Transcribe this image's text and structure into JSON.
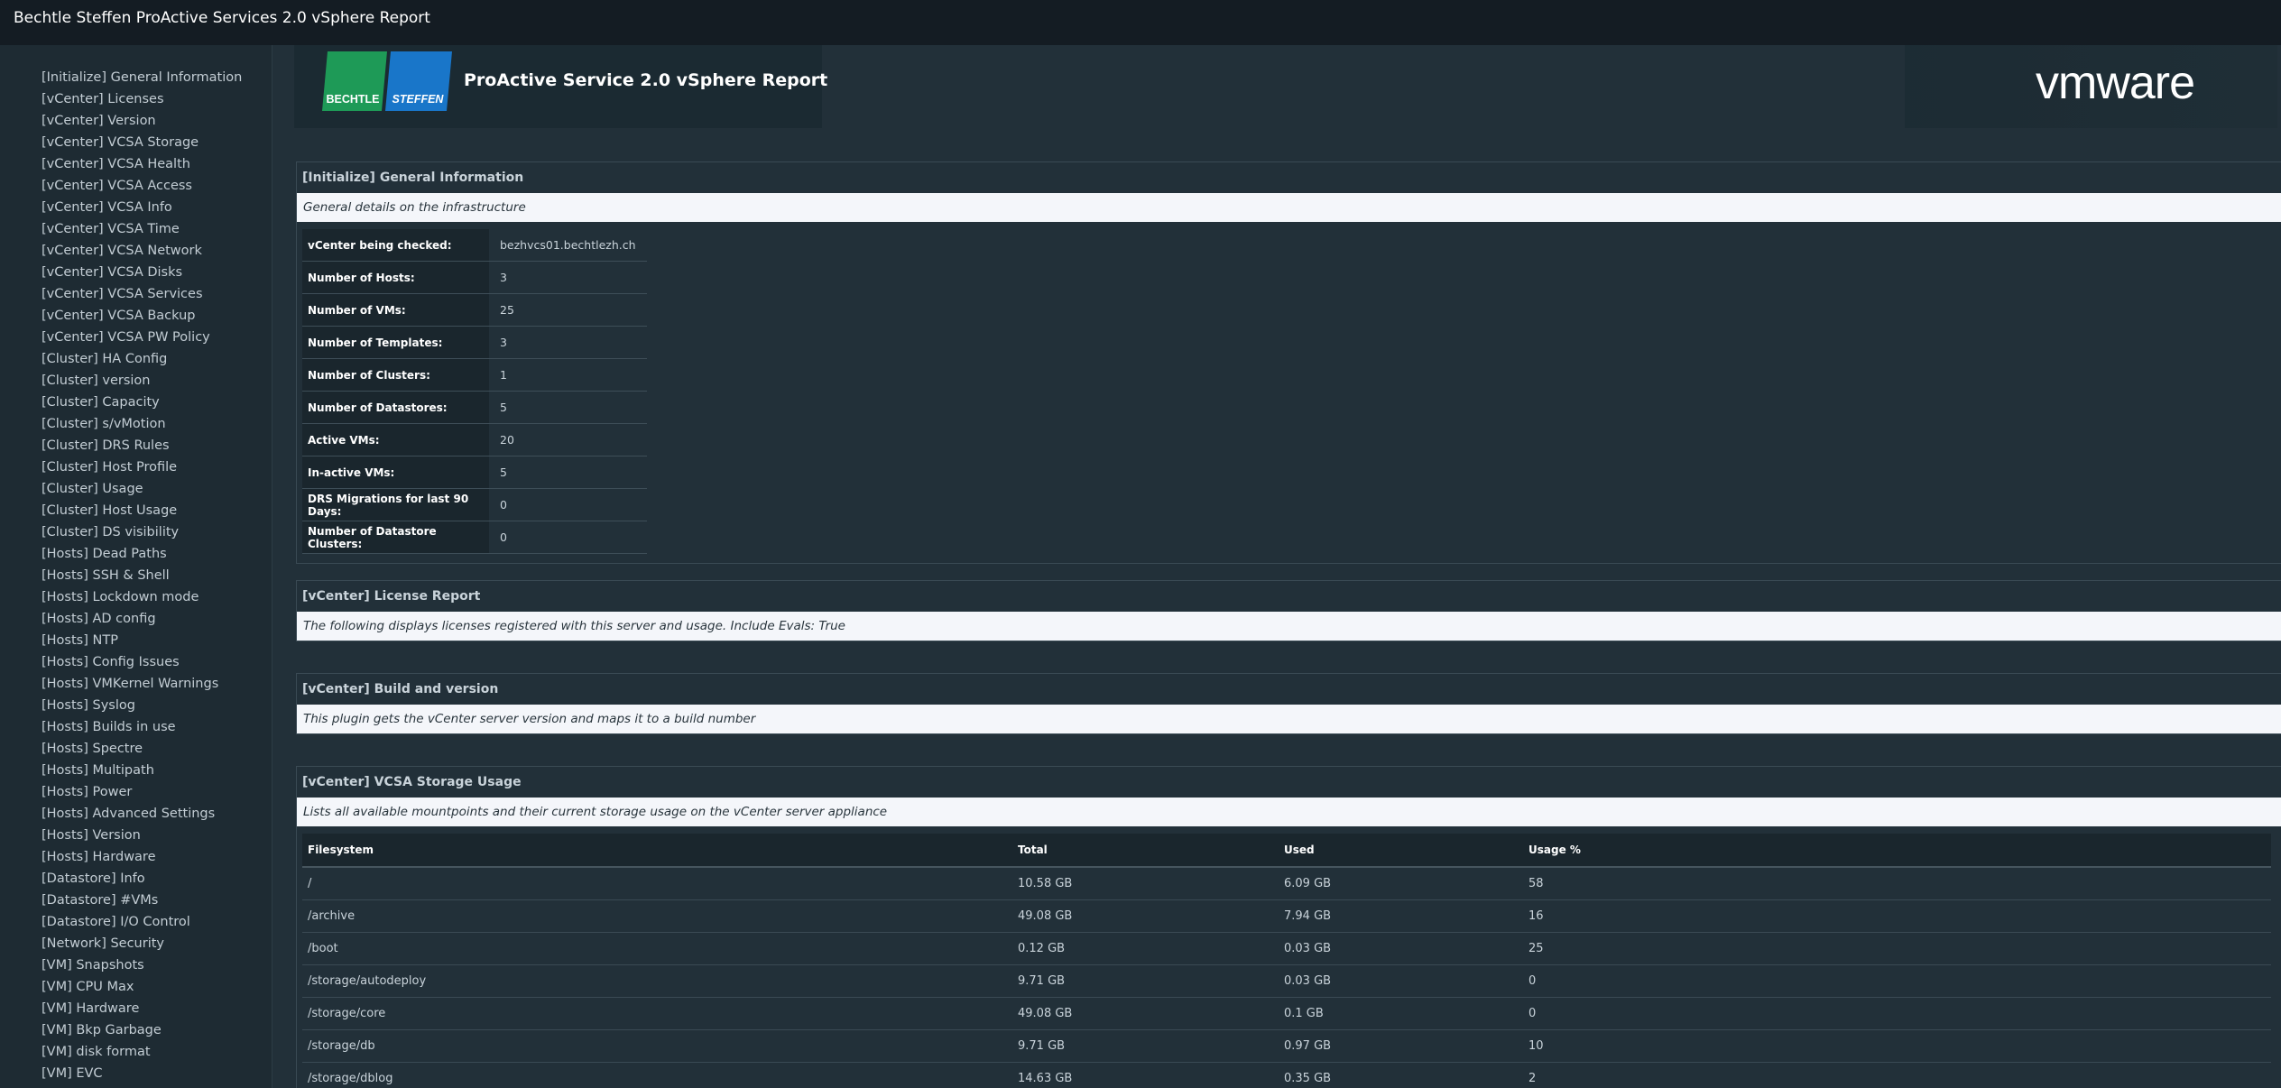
{
  "window": {
    "title": "Bechtle Steffen ProActive Services 2.0 vSphere Report"
  },
  "header": {
    "logo_text_1": "BECHTLE",
    "logo_text_2": "STEFFEN",
    "title": "ProActive Service 2.0 vSphere Report",
    "vmware_logo": "vmware"
  },
  "sidebar": {
    "items": [
      "[Initialize] General Information",
      "[vCenter] Licenses",
      "[vCenter] Version",
      "[vCenter] VCSA Storage",
      "[vCenter] VCSA Health",
      "[vCenter] VCSA Access",
      "[vCenter] VCSA Info",
      "[vCenter] VCSA Time",
      "[vCenter] VCSA Network",
      "[vCenter] VCSA Disks",
      "[vCenter] VCSA Services",
      "[vCenter] VCSA Backup",
      "[vCenter] VCSA PW Policy",
      "[Cluster] HA Config",
      "[Cluster] version",
      "[Cluster] Capacity",
      "[Cluster] s/vMotion",
      "[Cluster] DRS Rules",
      "[Cluster] Host Profile",
      "[Cluster] Usage",
      "[Cluster] Host Usage",
      "[Cluster] DS visibility",
      "[Hosts] Dead Paths",
      "[Hosts] SSH & Shell",
      "[Hosts] Lockdown mode",
      "[Hosts] AD config",
      "[Hosts] NTP",
      "[Hosts] Config Issues",
      "[Hosts] VMKernel Warnings",
      "[Hosts] Syslog",
      "[Hosts] Builds in use",
      "[Hosts] Spectre",
      "[Hosts] Multipath",
      "[Hosts] Power",
      "[Hosts] Advanced Settings",
      "[Hosts] Version",
      "[Hosts] Hardware",
      "[Datastore] Info",
      "[Datastore] #VMs",
      "[Datastore] I/O Control",
      "[Network] Security",
      "[VM] Snapshots",
      "[VM] CPU Max",
      "[VM] Hardware",
      "[VM] Bkp Garbage",
      "[VM] disk format",
      "[VM] EVC"
    ]
  },
  "general": {
    "title": "[Initialize] General Information",
    "description": "General details on the infrastructure",
    "rows": [
      {
        "k": "vCenter being checked:",
        "v": "bezhvcs01.bechtlezh.ch"
      },
      {
        "k": "Number of Hosts:",
        "v": "3"
      },
      {
        "k": "Number of VMs:",
        "v": "25"
      },
      {
        "k": "Number of Templates:",
        "v": "3"
      },
      {
        "k": "Number of Clusters:",
        "v": "1"
      },
      {
        "k": "Number of Datastores:",
        "v": "5"
      },
      {
        "k": "Active VMs:",
        "v": "20"
      },
      {
        "k": "In-active VMs:",
        "v": "5"
      },
      {
        "k": "DRS Migrations for last 90 Days:",
        "v": "0"
      },
      {
        "k": "Number of Datastore Clusters:",
        "v": "0"
      }
    ]
  },
  "license": {
    "title": "[vCenter] License Report",
    "description": "The following displays licenses registered with this server and usage. Include Evals: True"
  },
  "build": {
    "title": "[vCenter] Build and version",
    "description": "This plugin gets the vCenter server version and maps it to a build number"
  },
  "storage": {
    "title": "[vCenter] VCSA Storage Usage",
    "description": "Lists all available mountpoints and their current storage usage on the vCenter server appliance",
    "columns": [
      "Filesystem",
      "Total",
      "Used",
      "Usage %"
    ],
    "rows": [
      [
        "/",
        "10.58 GB",
        "6.09 GB",
        "58"
      ],
      [
        "/archive",
        "49.08 GB",
        "7.94 GB",
        "16"
      ],
      [
        "/boot",
        "0.12 GB",
        "0.03 GB",
        "25"
      ],
      [
        "/storage/autodeploy",
        "9.71 GB",
        "0.03 GB",
        "0"
      ],
      [
        "/storage/core",
        "49.08 GB",
        "0.1 GB",
        "0"
      ],
      [
        "/storage/db",
        "9.71 GB",
        "0.97 GB",
        "10"
      ],
      [
        "/storage/dblog",
        "14.63 GB",
        "0.35 GB",
        "2"
      ]
    ]
  }
}
